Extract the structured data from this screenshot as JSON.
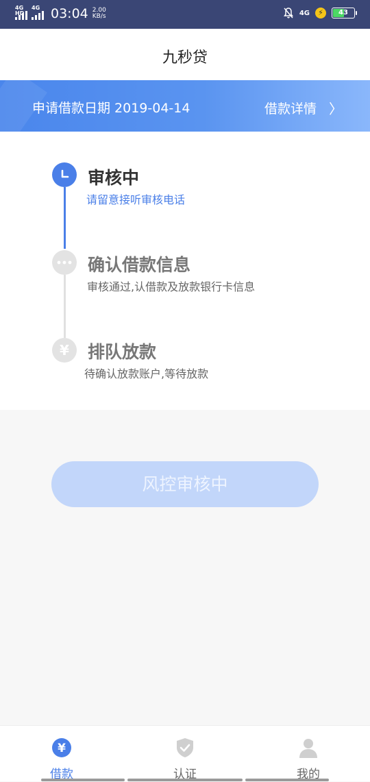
{
  "status_bar": {
    "sim1": "4G HD",
    "sim2": "4G",
    "time": "03:04",
    "speed_value": "2.00",
    "speed_unit": "KB/s",
    "network": "4G",
    "battery": "43"
  },
  "header": {
    "title": "九秒贷"
  },
  "banner": {
    "date_label": "申请借款日期 2019-04-14",
    "detail_label": "借款详情",
    "chevron": "〉"
  },
  "steps": [
    {
      "title": "审核中",
      "subtitle": "请留意接听审核电话",
      "icon": "clock-icon",
      "state": "active"
    },
    {
      "title": "确认借款信息",
      "subtitle": "审核通过,认借款及放款银行卡信息",
      "icon": "dots-icon",
      "state": "inactive"
    },
    {
      "title": "排队放款",
      "subtitle": "待确认放款账户,等待放款",
      "icon": "yen-icon",
      "state": "inactive"
    }
  ],
  "action_button": {
    "label": "风控审核中"
  },
  "tabs": [
    {
      "label": "借款",
      "icon": "yen-coin-icon",
      "active": true
    },
    {
      "label": "认证",
      "icon": "shield-check-icon",
      "active": false
    },
    {
      "label": "我的",
      "icon": "user-icon",
      "active": false
    }
  ],
  "colors": {
    "accent": "#4a7fe8",
    "status_bar": "#3a4675",
    "button_disabled": "#c2d6fa"
  }
}
